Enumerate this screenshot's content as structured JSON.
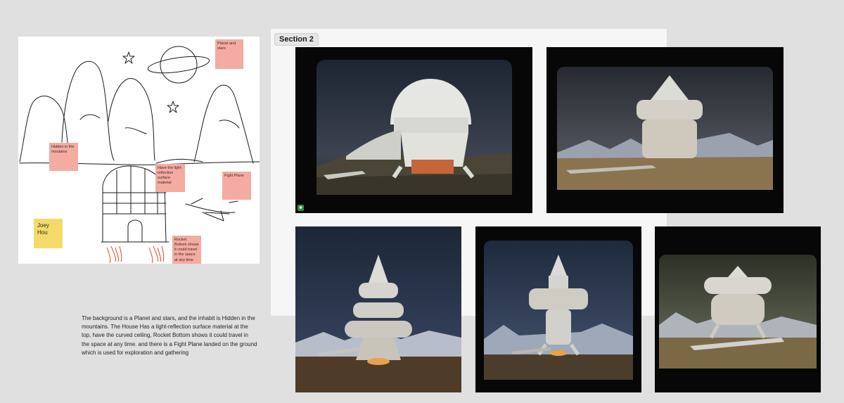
{
  "board": {
    "sticky_notes": [
      {
        "text": "Planet and stars"
      },
      {
        "text": "Hidden in the moutains"
      },
      {
        "text": "Have the light reflection surface material"
      },
      {
        "text": "Fight Plane"
      },
      {
        "text": "Rocket Bottom shows it could travel in the space at any time"
      }
    ],
    "author_note": "Joey Hou"
  },
  "description": "The background is a Planet and stars, and the inhabit is Hidden in the mountains.  The House Has a light-reflection surface material at the top, have the curved ceiling, Rocket Bottom shows it could travel in the space at any time. and there is a Fight Plane landed on the ground which is used for exploration and gathering",
  "section": {
    "label": "Section 2"
  },
  "colors": {
    "canvas": "#e0e0e0",
    "sticky_pink": "#f4aba1",
    "sticky_yellow": "#f5da6b",
    "tile_frame": "#070707"
  },
  "icons": {
    "tile_badge": "app-badge-icon"
  }
}
